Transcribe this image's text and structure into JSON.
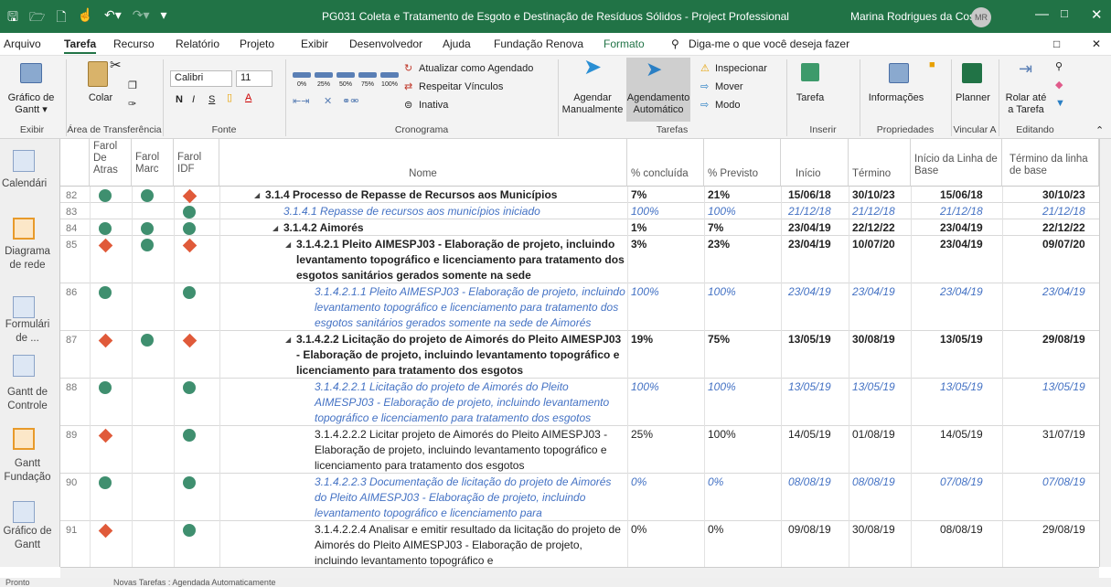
{
  "window": {
    "title": "PG031 Coleta e Tratamento de Esgoto e Destinação de Resíduos Sólidos  -  Project Professional",
    "user": "Marina Rodrigues da Costa",
    "avatar": "MR",
    "minimize": "—",
    "restore": "□",
    "close": "✕"
  },
  "quick_access": [
    "save-icon",
    "open-icon",
    "new-icon",
    "touch-icon",
    "undo-icon",
    "redo-icon",
    "customize-icon"
  ],
  "menu": {
    "items": [
      "Arquivo",
      "Tarefa",
      "Recurso",
      "Relatório",
      "Projeto",
      "Exibir",
      "Desenvolvedor",
      "Ajuda",
      "Fundação Renova",
      "Formato"
    ],
    "search": "Diga-me o que você deseja fazer"
  },
  "ribbon": {
    "gantt": "Gráfico de Gantt ▾",
    "paste": "Colar",
    "font_name": "Calibri",
    "font_size": "11",
    "bold": "N",
    "italic": "I",
    "underline": "S",
    "auto_update": "Atualizar como Agendado",
    "respect": "Respeitar Vínculos",
    "inactive": "Inativa",
    "manual": "Agendar Manualmente",
    "auto": "Agendamento Automático",
    "inspect": "Inspecionar",
    "move": "Mover",
    "mode": "Modo",
    "task": "Tarefa",
    "info": "Informações",
    "planner": "Planner",
    "scroll": "Rolar até a Tarefa",
    "percent_labels": [
      "0%",
      "25%",
      "50%",
      "75%",
      "100%"
    ],
    "groups": [
      "Exibir",
      "Área de Transferência",
      "Fonte",
      "Cronograma",
      "Tarefas",
      "Inserir",
      "Propriedades",
      "Vincular A",
      "Editando"
    ]
  },
  "sidebar": [
    "Calendári",
    "Diagrama de rede",
    "Formulári de ...",
    "Gantt de Controle",
    "Gantt Fundação",
    "Gráfico de Gantt"
  ],
  "columns": [
    "Farol De Atras",
    "Farol Marc",
    "Farol IDF",
    "Nome",
    "% concluída",
    "% Previsto",
    "Início",
    "Término",
    "Início da Linha de Base",
    "Término da linha de base"
  ],
  "rows": [
    {
      "id": "82",
      "f": [
        "g",
        "g",
        "r"
      ],
      "name": "3.1.4 Processo de Repasse de Recursos aos Municípios",
      "pct": "7%",
      "prev": "21%",
      "start": "15/06/18",
      "end": "30/10/23",
      "bs": "15/06/18",
      "be": "30/10/23",
      "style": "summary",
      "level": 0
    },
    {
      "id": "83",
      "f": [
        "",
        "",
        "g"
      ],
      "name": "3.1.4.1 Repasse de recursos aos municípios iniciado",
      "pct": "100%",
      "prev": "100%",
      "start": "21/12/18",
      "end": "21/12/18",
      "bs": "21/12/18",
      "be": "21/12/18",
      "style": "done",
      "level": 1
    },
    {
      "id": "84",
      "f": [
        "g",
        "g",
        "g"
      ],
      "name": "3.1.4.2 Aimorés",
      "pct": "1%",
      "prev": "7%",
      "start": "23/04/19",
      "end": "22/12/22",
      "bs": "23/04/19",
      "be": "22/12/22",
      "style": "summary",
      "level": 1
    },
    {
      "id": "85",
      "f": [
        "r",
        "g",
        "r"
      ],
      "name": "3.1.4.2.1 Pleito AIMESPJ03 - Elaboração de projeto, incluindo levantamento topográfico e licenciamento para tratamento dos esgotos sanitários gerados somente na sede",
      "pct": "3%",
      "prev": "23%",
      "start": "23/04/19",
      "end": "10/07/20",
      "bs": "23/04/19",
      "be": "09/07/20",
      "style": "summary",
      "level": 2
    },
    {
      "id": "86",
      "f": [
        "g",
        "",
        "g"
      ],
      "name": "3.1.4.2.1.1 Pleito AIMESPJ03 - Elaboração de projeto, incluindo levantamento topográfico e licenciamento para tratamento dos esgotos sanitários gerados somente na sede de Aimorés",
      "pct": "100%",
      "prev": "100%",
      "start": "23/04/19",
      "end": "23/04/19",
      "bs": "23/04/19",
      "be": "23/04/19",
      "style": "done",
      "level": 3
    },
    {
      "id": "87",
      "f": [
        "r",
        "g",
        "r"
      ],
      "name": "3.1.4.2.2 Licitação do projeto de Aimorés do Pleito AIMESPJ03 - Elaboração de projeto, incluindo levantamento topográfico e licenciamento para tratamento dos esgotos",
      "pct": "19%",
      "prev": "75%",
      "start": "13/05/19",
      "end": "30/08/19",
      "bs": "13/05/19",
      "be": "29/08/19",
      "style": "summary",
      "level": 2
    },
    {
      "id": "88",
      "f": [
        "g",
        "",
        "g"
      ],
      "name": "3.1.4.2.2.1 Licitação do projeto de Aimorés do Pleito AIMESPJ03 - Elaboração de projeto, incluindo levantamento topográfico e licenciamento para tratamento dos esgotos",
      "pct": "100%",
      "prev": "100%",
      "start": "13/05/19",
      "end": "13/05/19",
      "bs": "13/05/19",
      "be": "13/05/19",
      "style": "done",
      "level": 3
    },
    {
      "id": "89",
      "f": [
        "r",
        "",
        "g"
      ],
      "name": "3.1.4.2.2.2 Licitar projeto de Aimorés do Pleito AIMESPJ03 - Elaboração de projeto, incluindo levantamento topográfico e licenciamento para tratamento dos esgotos",
      "pct": "25%",
      "prev": "100%",
      "start": "14/05/19",
      "end": "01/08/19",
      "bs": "14/05/19",
      "be": "31/07/19",
      "style": "normal",
      "level": 3
    },
    {
      "id": "90",
      "f": [
        "g",
        "",
        "g"
      ],
      "name": "3.1.4.2.2.3 Documentação de licitação do projeto de Aimorés do Pleito AIMESPJ03 - Elaboração de projeto, incluindo levantamento topográfico e licenciamento para",
      "pct": "0%",
      "prev": "0%",
      "start": "08/08/19",
      "end": "08/08/19",
      "bs": "07/08/19",
      "be": "07/08/19",
      "style": "done",
      "level": 3
    },
    {
      "id": "91",
      "f": [
        "r",
        "",
        "g"
      ],
      "name": "3.1.4.2.2.4 Analisar e emitir resultado da licitação do projeto de Aimorés do Pleito AIMESPJ03 - Elaboração de projeto, incluindo levantamento topográfico e",
      "pct": "0%",
      "prev": "0%",
      "start": "09/08/19",
      "end": "30/08/19",
      "bs": "08/08/19",
      "be": "29/08/19",
      "style": "normal",
      "level": 3
    }
  ],
  "status": {
    "ready": "Pronto",
    "new_tasks": "Novas Tarefas : Agendada Automaticamente"
  },
  "colors": {
    "green": "#217346",
    "dot_green": "#3f8f6f",
    "dot_red": "#e05a3a",
    "done_blue": "#4472c4"
  }
}
